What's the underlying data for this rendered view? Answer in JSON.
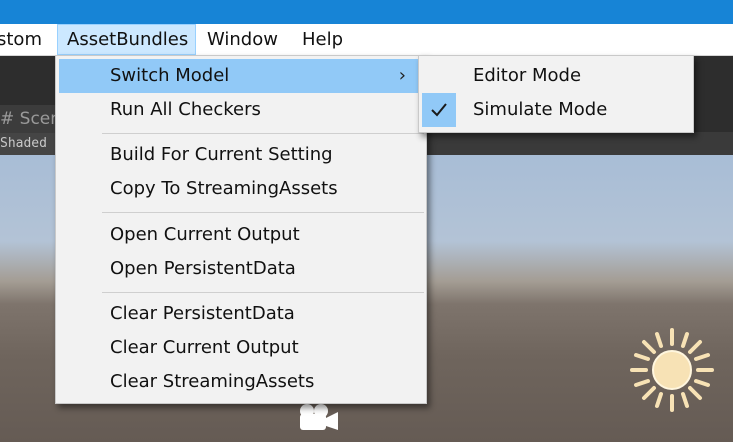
{
  "menubar": {
    "items": [
      {
        "label": "stom"
      },
      {
        "label": "AssetBundles"
      },
      {
        "label": "Window"
      },
      {
        "label": "Help"
      }
    ]
  },
  "scene": {
    "tab_label": "# Scen",
    "shading_mode": "Shaded"
  },
  "dropdown": {
    "items": [
      {
        "label": "Switch Model",
        "has_submenu": true,
        "highlighted": true
      },
      {
        "label": "Run All Checkers"
      },
      {
        "label": "Build For Current Setting"
      },
      {
        "label": "Copy To StreamingAssets"
      },
      {
        "label": "Open Current Output"
      },
      {
        "label": "Open PersistentData"
      },
      {
        "label": "Clear PersistentData"
      },
      {
        "label": "Clear Current Output"
      },
      {
        "label": "Clear StreamingAssets"
      }
    ],
    "submenu_arrow": "›"
  },
  "submenu": {
    "items": [
      {
        "label": "Editor Mode",
        "checked": false
      },
      {
        "label": "Simulate Mode",
        "checked": true
      }
    ]
  },
  "colors": {
    "title_strip": "#1784d6",
    "menu_highlight": "#91c9f7",
    "menubar_active": "#cce8ff",
    "sun": "#f7e2b5"
  },
  "icons": [
    "check-icon",
    "chevron-right-icon",
    "sun-icon",
    "camera-icon"
  ]
}
